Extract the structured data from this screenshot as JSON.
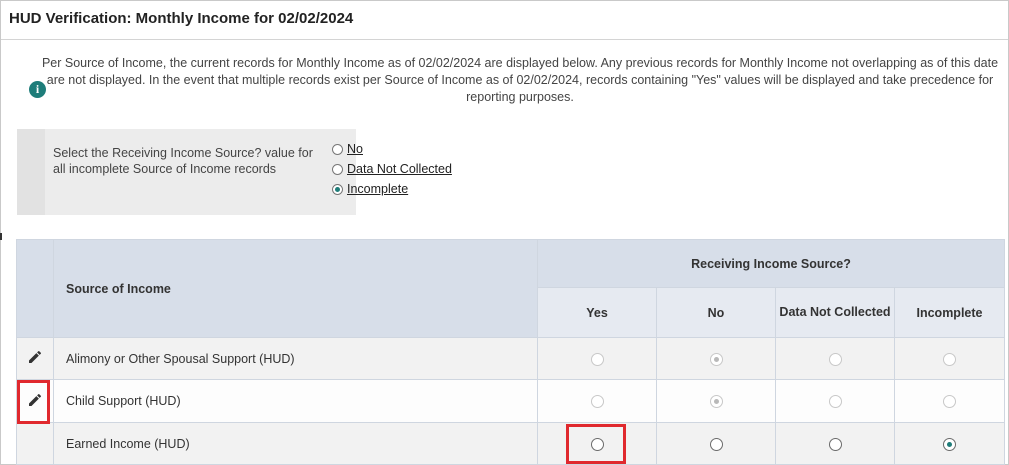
{
  "header": {
    "title": "HUD Verification: Monthly Income for 02/02/2024"
  },
  "notice": {
    "icon": "info-icon",
    "text": "Per Source of Income, the current records for Monthly Income as of 02/02/2024 are displayed below. Any previous records for Monthly Income not overlapping as of this date are not displayed. In the event that multiple records exist per Source of Income as of 02/02/2024, records containing \"Yes\" values will be displayed and take precedence for reporting purposes."
  },
  "bulk_select": {
    "label": "Select the Receiving Income Source? value for all incomplete Source of Income records",
    "options": [
      {
        "label": "No",
        "selected": false
      },
      {
        "label": "Data Not Collected",
        "selected": false
      },
      {
        "label": "Incomplete",
        "selected": true
      }
    ]
  },
  "table": {
    "col_source": "Source of Income",
    "group_header": "Receiving Income Source?",
    "col_yes": "Yes",
    "col_no": "No",
    "col_dnc": "Data Not Collected",
    "col_incomplete": "Incomplete",
    "rows": [
      {
        "source": "Alimony or Other Spousal Support (HUD)",
        "selected": "No",
        "disabled": true,
        "editable": true
      },
      {
        "source": "Child Support (HUD)",
        "selected": "No",
        "disabled": true,
        "editable": true
      },
      {
        "source": "Earned Income (HUD)",
        "selected": "Incomplete",
        "disabled": false,
        "editable": false
      }
    ]
  },
  "colors": {
    "accent": "#1f7d79",
    "highlight": "#e0292e",
    "header_bg": "#d7dee9"
  }
}
